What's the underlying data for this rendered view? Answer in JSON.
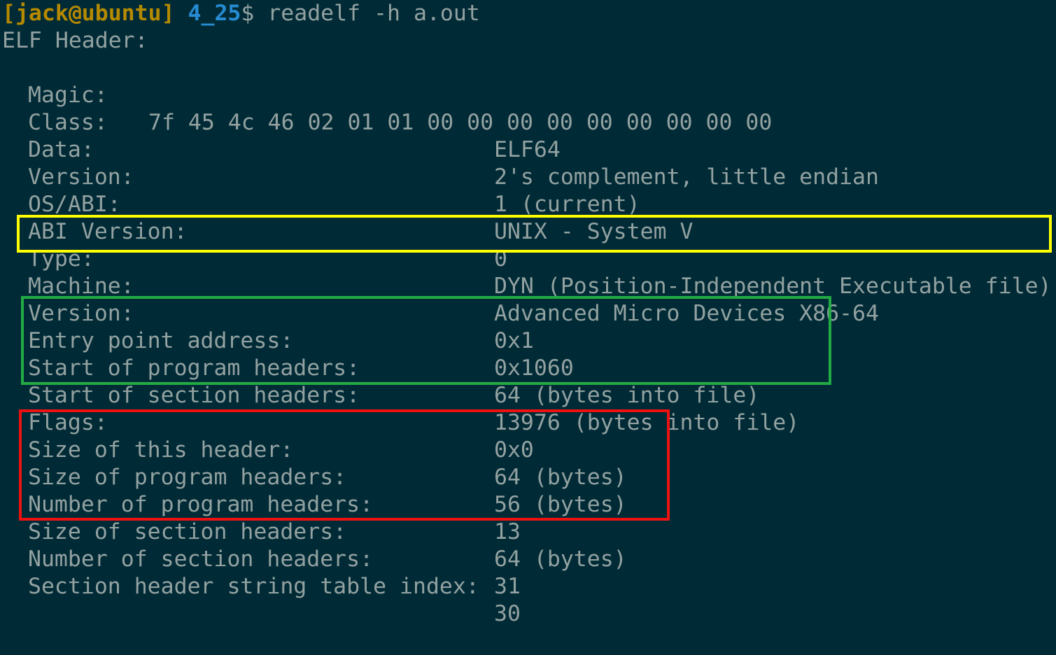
{
  "prompt": {
    "bracket_open": "[",
    "user_host": "jack@ubuntu",
    "bracket_close": "]",
    "directory": "4_25",
    "dollar": "$",
    "command": "readelf -h a.out"
  },
  "header_title": "ELF Header:",
  "magic": {
    "label": "Magic:",
    "value": "7f 45 4c 46 02 01 01 00 00 00 00 00 00 00 00 00"
  },
  "fields": [
    {
      "label": "Class:",
      "value": "ELF64"
    },
    {
      "label": "Data:",
      "value": "2's complement, little endian"
    },
    {
      "label": "Version:",
      "value": "1 (current)"
    },
    {
      "label": "OS/ABI:",
      "value": "UNIX - System V"
    },
    {
      "label": "ABI Version:",
      "value": "0"
    },
    {
      "label": "Type:",
      "value": "DYN (Position-Independent Executable file)"
    },
    {
      "label": "Machine:",
      "value": "Advanced Micro Devices X86-64"
    },
    {
      "label": "Version:",
      "value": "0x1"
    },
    {
      "label": "Entry point address:",
      "value": "0x1060"
    },
    {
      "label": "Start of program headers:",
      "value": "64 (bytes into file)"
    },
    {
      "label": "Start of section headers:",
      "value": "13976 (bytes into file)"
    },
    {
      "label": "Flags:",
      "value": "0x0"
    },
    {
      "label": "Size of this header:",
      "value": "64 (bytes)"
    },
    {
      "label": "Size of program headers:",
      "value": "56 (bytes)"
    },
    {
      "label": "Number of program headers:",
      "value": "13"
    },
    {
      "label": "Size of section headers:",
      "value": "64 (bytes)"
    },
    {
      "label": "Number of section headers:",
      "value": "31"
    },
    {
      "label": "Section header string table index:",
      "value": "30"
    }
  ],
  "colors": {
    "background": "#002b36",
    "text": "#93a1a1",
    "prompt_user": "#b58900",
    "prompt_dir": "#268bd2",
    "highlight_yellow": "#ffff00",
    "highlight_green": "#22aa44",
    "highlight_red": "#ee1111"
  }
}
